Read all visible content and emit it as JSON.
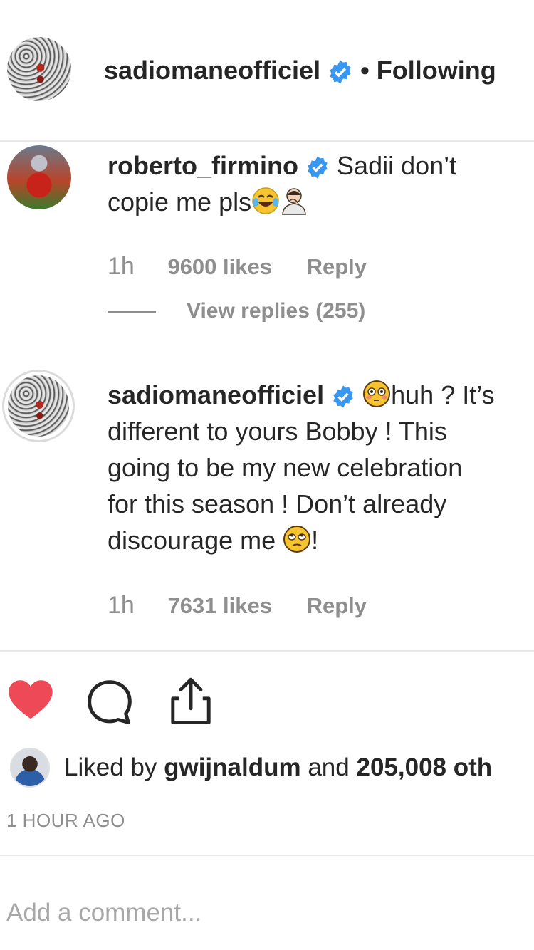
{
  "post_header": {
    "username": "sadiomaneofficiel",
    "separator": "•",
    "follow_status": "Following"
  },
  "comments": [
    {
      "username": "roberto_firmino",
      "line1": "Sadii don’t",
      "line2": "copie me pls",
      "time": "1h",
      "likes": "9600 likes",
      "reply_label": "Reply",
      "view_replies": "View replies (255)"
    },
    {
      "username": "sadiomaneofficiel",
      "line1": "huh ? It’s",
      "line2": "different to yours Bobby ! This",
      "line3": "going to be my new celebration",
      "line4": "for this season ! Don’t already",
      "line5": "discourage me",
      "line5_end": "!",
      "time": "1h",
      "likes": "7631 likes",
      "reply_label": "Reply"
    }
  ],
  "engagement": {
    "liked_prefix": "Liked by",
    "liked_user": "gwijnaldum",
    "liked_and": "and",
    "liked_others": "205,008 oth"
  },
  "timestamp": "1 HOUR AGO",
  "comment_input": {
    "placeholder": "Add a comment..."
  },
  "icons": {
    "like": "heart-icon-filled",
    "comment": "comment-bubble-icon",
    "share": "share-upload-icon",
    "verified": "verified-badge-icon"
  },
  "colors": {
    "heart": "#ed4956",
    "verified": "#3897f0",
    "secondary_text": "#8e8e8e"
  }
}
